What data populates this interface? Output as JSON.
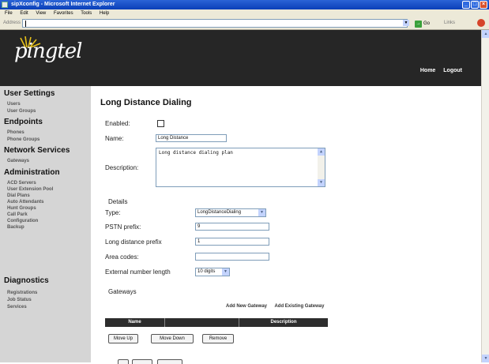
{
  "window": {
    "title": "sipXconfig - Microsoft Internet Explorer"
  },
  "menubar": {
    "items": [
      "File",
      "Edit",
      "View",
      "Favorites",
      "Tools",
      "Help"
    ]
  },
  "addressbar": {
    "label": "Address",
    "value": "",
    "go_label": "Go",
    "links_label": "Links"
  },
  "brand": {
    "logo": "pingtel"
  },
  "topnav": {
    "home": "Home",
    "logout": "Logout"
  },
  "sidebar": {
    "sections": [
      {
        "title": "User Settings",
        "items": [
          "Users",
          "User Groups"
        ]
      },
      {
        "title": "Endpoints",
        "items": [
          "Phones",
          "Phone Groups"
        ]
      },
      {
        "title": "Network Services",
        "items": [
          "Gateways"
        ]
      },
      {
        "title": "Administration",
        "items": [
          "ACD Servers",
          "User Extension Pool",
          "Dial Plans",
          "Auto Attendants",
          "Hunt Groups",
          "Call Park",
          "Configuration",
          "Backup"
        ]
      },
      {
        "title": "Diagnostics",
        "items": [
          "Registrations",
          "Job Status",
          "Services"
        ]
      }
    ]
  },
  "page": {
    "title": "Long Distance Dialing"
  },
  "form": {
    "enabled_label": "Enabled:",
    "name_label": "Name:",
    "name_value": "Long Distance",
    "description_label": "Description:",
    "description_value": "Long distance dialing plan",
    "details_label": "Details",
    "type_label": "Type:",
    "type_value": "LongDistanceDialing",
    "pstn_label": "PSTN prefix:",
    "pstn_value": "9",
    "ld_prefix_label": "Long distance prefix",
    "ld_prefix_value": "1",
    "area_codes_label": "Area codes:",
    "area_codes_value": "",
    "ext_len_label": "External number length",
    "ext_len_value": "10 digits"
  },
  "gateways": {
    "label": "Gateways",
    "add_new": "Add New Gateway",
    "add_existing": "Add Existing Gateway",
    "columns": [
      "Name",
      "",
      "Description"
    ],
    "buttons": {
      "move_up": "Move Up",
      "move_down": "Move Down",
      "remove": "Remove"
    }
  },
  "colors": {
    "header_bg": "#262626",
    "sidebar_bg": "#d5d5d5",
    "logo_accent": "#e8c21a"
  }
}
